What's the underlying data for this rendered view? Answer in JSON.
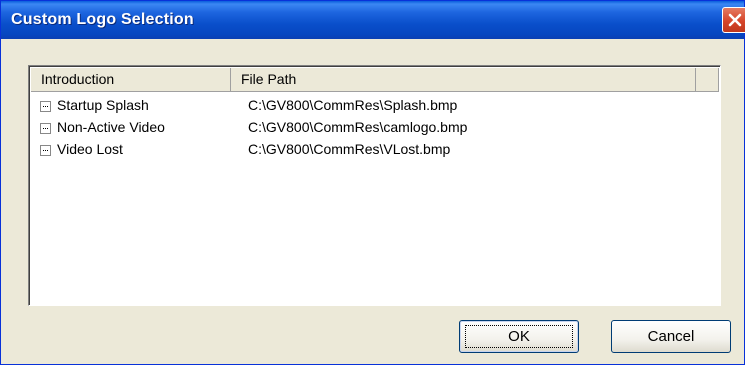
{
  "window": {
    "title": "Custom Logo Selection",
    "close_icon": "close-icon"
  },
  "list": {
    "columns": [
      "Introduction",
      "File Path",
      ""
    ],
    "rows": [
      {
        "introduction": "Startup Splash",
        "file_path": "C:\\GV800\\CommRes\\Splash.bmp"
      },
      {
        "introduction": "Non-Active Video",
        "file_path": "C:\\GV800\\CommRes\\camlogo.bmp"
      },
      {
        "introduction": "Video Lost",
        "file_path": "C:\\GV800\\CommRes\\VLost.bmp"
      }
    ]
  },
  "buttons": {
    "ok": "OK",
    "cancel": "Cancel"
  },
  "colors": {
    "titlebar": "#0a4fcb",
    "close_button": "#d6452a",
    "dialog_bg": "#ece9d8"
  }
}
